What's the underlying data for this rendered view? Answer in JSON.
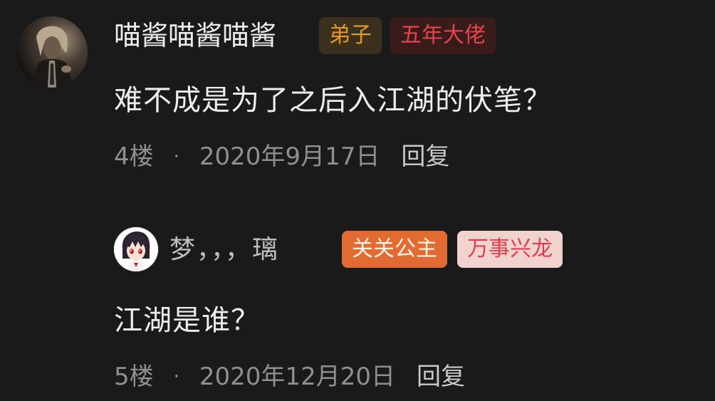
{
  "comments": [
    {
      "username": "喵酱喵酱喵酱",
      "badges": [
        {
          "label": "弟子",
          "bg": "#3b2f1d",
          "color": "#e19a2a"
        },
        {
          "label": "五年大佬",
          "bg": "#3a1b1c",
          "color": "#e2454a"
        }
      ],
      "text": "难不成是为了之后入江湖的伏笔？",
      "floor": "4楼",
      "separator": "·",
      "date": "2020年9月17日",
      "reply": "回复"
    },
    {
      "username": "梦，，，璃",
      "badges": [
        {
          "label": "关关公主",
          "bg": "#e26a33",
          "color": "#fff1e6"
        },
        {
          "label": "万事兴龙",
          "bg": "#f1d3ce",
          "color": "#df3e52"
        }
      ],
      "text": "江湖是谁？",
      "floor": "5楼",
      "separator": "·",
      "date": "2020年12月20日",
      "reply": "回复"
    }
  ],
  "colors": {
    "background": "#1a1a1a",
    "primary_text": "#ededed",
    "meta_text": "#8f8f8f"
  }
}
